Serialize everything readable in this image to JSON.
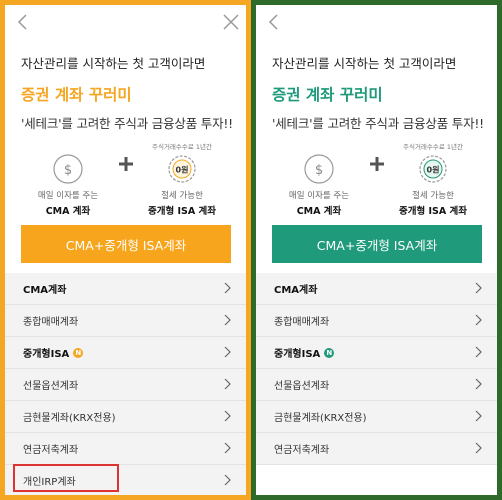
{
  "lead": "자산관리를 시작하는 첫 고객이라면",
  "headline": "증권 계좌 꾸러미",
  "tagline": "'세테크'를 고려한 주식과 금융상품 투자!!",
  "feature_left": {
    "sub": "매일 이자를 주는",
    "title": "CMA 계좌"
  },
  "feature_right": {
    "note": "주식거래수수료 1년간",
    "sub": "절세 가능한",
    "title": "중개형 ISA 계좌",
    "coin_text": "0원"
  },
  "cta": "CMA+중개형 ISA계좌",
  "accounts": [
    {
      "label": "CMA계좌"
    },
    {
      "label": "종합매매계좌"
    },
    {
      "label": "중개형ISA",
      "badge": "N"
    },
    {
      "label": "선물옵션계좌"
    },
    {
      "label": "금현물계좌(KRX전용)"
    },
    {
      "label": "연금저축계좌"
    },
    {
      "label": "개인IRP계좌"
    }
  ],
  "colors": {
    "left_border": "#f5a623",
    "right_border": "#2e6b2a",
    "left_accent": "#f7a51c",
    "right_accent": "#1f9a7a"
  }
}
